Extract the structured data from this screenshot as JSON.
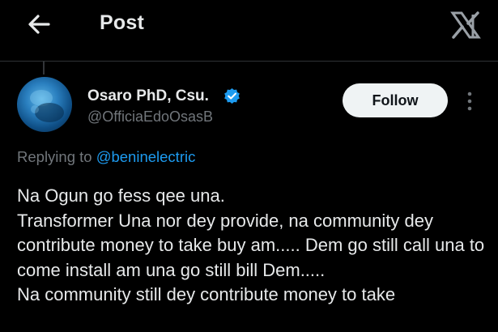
{
  "header": {
    "title": "Post",
    "back_icon": "arrow-left-icon",
    "brand_icon": "x-logo-icon"
  },
  "post": {
    "author": {
      "name": "Osaro PhD, Csu.",
      "handle": "@OfficiaEdoOsasB",
      "verified_icon": "verified-badge-icon"
    },
    "follow_label": "Follow",
    "more_icon": "more-vertical-icon",
    "replying_prefix": "Replying to",
    "replying_to": "@beninelectric",
    "text": "Na Ogun go fess qee una.\nTransformer Una nor dey provide, na community dey contribute money to take buy am..... Dem go still call una to come install am una go still bill Dem.....\nNa community still dey contribute money to take"
  },
  "colors": {
    "background": "#000000",
    "text_primary": "#e7e9ea",
    "text_secondary": "#71767b",
    "accent": "#1d9bf0",
    "follow_bg": "#eff3f4",
    "divider": "#2f3336"
  }
}
